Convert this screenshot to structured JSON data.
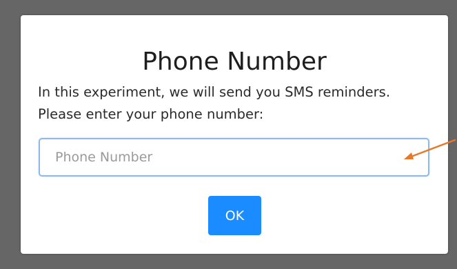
{
  "dialog": {
    "title": "Phone Number",
    "message": "In this experiment, we will send you SMS reminders. Please enter your phone number:",
    "phone_input": {
      "value": "",
      "placeholder": "Phone Number"
    },
    "ok_label": "OK"
  },
  "colors": {
    "backdrop": "#666666",
    "accent": "#1a8cff",
    "input_border": "#8fb9e8",
    "annotation_arrow": "#e8782a"
  },
  "annotation": {
    "icon": "arrow-left-icon"
  }
}
